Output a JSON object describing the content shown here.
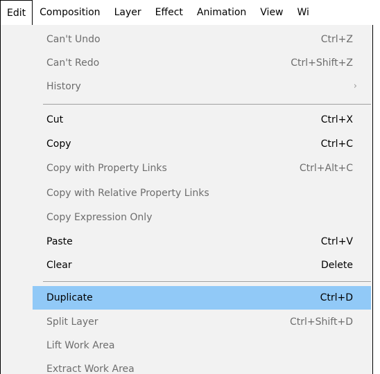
{
  "menubar": {
    "items": [
      "Edit",
      "Composition",
      "Layer",
      "Effect",
      "Animation",
      "View",
      "Wi"
    ]
  },
  "colors": {
    "highlight": "#91c9f7",
    "menu_bg": "#f2f2f2",
    "disabled_text": "#6d6d6d"
  },
  "menu": {
    "undo": {
      "label": "Can't Undo",
      "shortcut": "Ctrl+Z"
    },
    "redo": {
      "label": "Can't Redo",
      "shortcut": "Ctrl+Shift+Z"
    },
    "history": {
      "label": "History",
      "arrow": "›"
    },
    "cut": {
      "label": "Cut",
      "shortcut": "Ctrl+X"
    },
    "copy": {
      "label": "Copy",
      "shortcut": "Ctrl+C"
    },
    "copy_prop_links": {
      "label": "Copy with Property Links",
      "shortcut": "Ctrl+Alt+C"
    },
    "copy_rel_prop_links": {
      "label": "Copy with Relative Property Links"
    },
    "copy_expression": {
      "label": "Copy Expression Only"
    },
    "paste": {
      "label": "Paste",
      "shortcut": "Ctrl+V"
    },
    "clear": {
      "label": "Clear",
      "shortcut": "Delete"
    },
    "duplicate": {
      "label": "Duplicate",
      "shortcut": "Ctrl+D"
    },
    "split_layer": {
      "label": "Split Layer",
      "shortcut": "Ctrl+Shift+D"
    },
    "lift_work_area": {
      "label": "Lift Work Area"
    },
    "extract_work_area": {
      "label": "Extract Work Area"
    }
  }
}
